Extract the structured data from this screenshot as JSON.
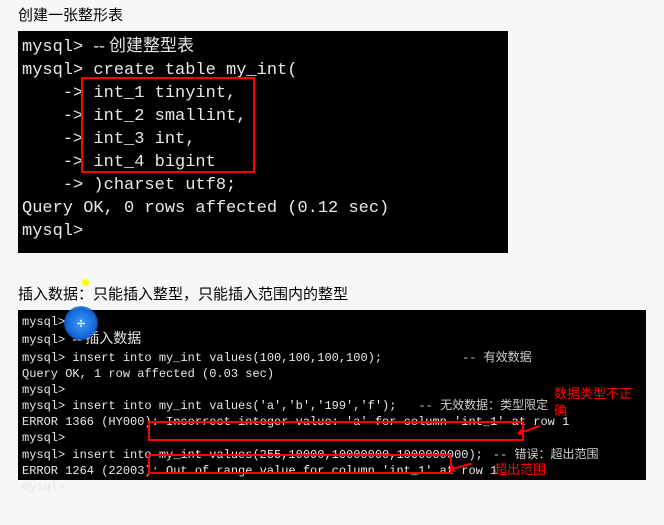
{
  "section1": {
    "heading": "创建一张整形表",
    "lines": {
      "l1a": "mysql> ",
      "l1b": "-- 创建整型表",
      "l2": "mysql> create table my_int(",
      "l3": "    -> int_1 tinyint,",
      "l4": "    -> int_2 smallint,",
      "l5": "    -> int_3 int,",
      "l6": "    -> int_4 bigint",
      "l7": "    -> )charset utf8;",
      "l8": "Query OK, 0 rows affected (0.12 sec)",
      "l9": "",
      "l10": "mysql>"
    }
  },
  "section2": {
    "heading": "插入数据：只能插入整型，只能插入范围内的整型",
    "lines": {
      "l1": "mysql>",
      "l2a": "mysql> ",
      "l2b": "-- 插入数据",
      "l3": "mysql> insert into my_int values(100,100,100,100);",
      "l3c": "-- 有效数据",
      "l4": "Query OK, 1 row affected (0.03 sec)",
      "l5": "",
      "l6": "mysql>",
      "l7": "mysql> insert into my_int values('a','b','199','f');",
      "l7c": "-- 无效数据：类型限定",
      "l8": "ERROR 1366 (HY000): Incorrect integer value: 'a' for column 'int_1' at row 1",
      "l9": "mysql>",
      "l10": "mysql> insert into my_int values(255,10000,10000000,1000000000);",
      "l10c": "-- 错误：超出范围",
      "l11": "ERROR 1264 (22003): Out of range value for column 'int_1' at row 1",
      "l12": "mysql>"
    },
    "annot": {
      "a1": "数据类型不正确",
      "a2": "超出范围"
    }
  }
}
